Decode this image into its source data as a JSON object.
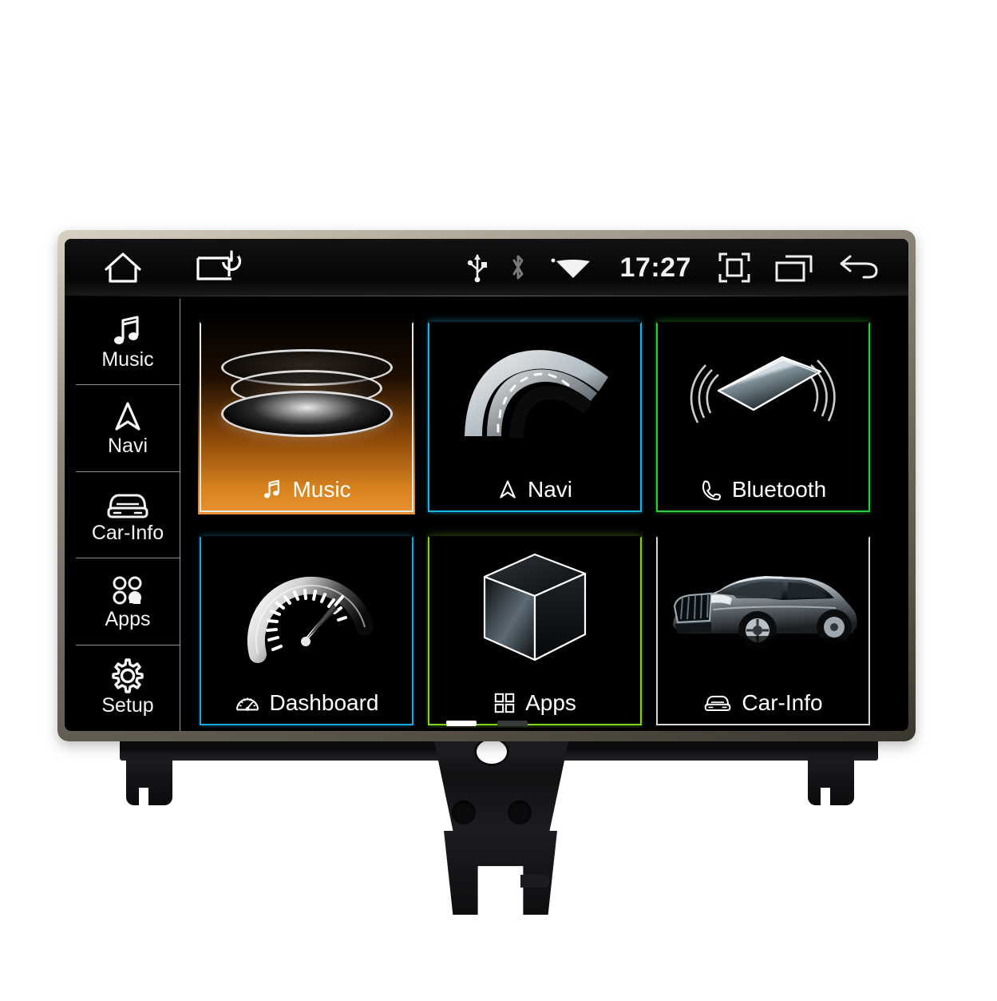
{
  "device": {
    "name": "car-head-unit",
    "bezel_color": "#8c8679"
  },
  "statusbar": {
    "home_label": "home-icon",
    "power_label": "screen-power-icon",
    "usb_label": "usb-icon",
    "bluetooth_label": "bluetooth-icon",
    "wifi_label": "wifi-icon",
    "time": "17:27",
    "screenshot_label": "screenshot-icon",
    "recents_label": "recent-apps-icon",
    "back_label": "back-icon"
  },
  "sidebar": {
    "items": [
      {
        "id": "music",
        "label": "Music",
        "icon": "music-note-icon"
      },
      {
        "id": "navi",
        "label": "Navi",
        "icon": "navigation-arrow-icon"
      },
      {
        "id": "carinfo",
        "label": "Car-Info",
        "icon": "car-front-icon"
      },
      {
        "id": "apps",
        "label": "Apps",
        "icon": "apps-circles-icon"
      },
      {
        "id": "setup",
        "label": "Setup",
        "icon": "gear-icon"
      }
    ]
  },
  "grid": {
    "tiles": [
      {
        "id": "music",
        "label": "Music",
        "cap_icon": "music-note-icon",
        "accent": "#e79334",
        "selected": true,
        "art": "disc-stack"
      },
      {
        "id": "navi",
        "label": "Navi",
        "cap_icon": "navigation-arrow-icon",
        "accent": "#17b4e8",
        "selected": false,
        "art": "road"
      },
      {
        "id": "bluetooth",
        "label": "Bluetooth",
        "cap_icon": "phone-handset-icon",
        "accent": "#2ecc38",
        "selected": false,
        "art": "phone-waves"
      },
      {
        "id": "dashboard",
        "label": "Dashboard",
        "cap_icon": "gauge-icon",
        "accent": "#1aa6dc",
        "selected": false,
        "art": "gauge"
      },
      {
        "id": "apps",
        "label": "Apps",
        "cap_icon": "grid-squares-icon",
        "accent": "#7ed321",
        "selected": false,
        "art": "cube"
      },
      {
        "id": "carinfo",
        "label": "Car-Info",
        "cap_icon": "car-front-icon",
        "accent": "#d8d8d8",
        "selected": false,
        "art": "car-photo"
      }
    ]
  },
  "pager": {
    "pages": 2,
    "current": 1
  }
}
